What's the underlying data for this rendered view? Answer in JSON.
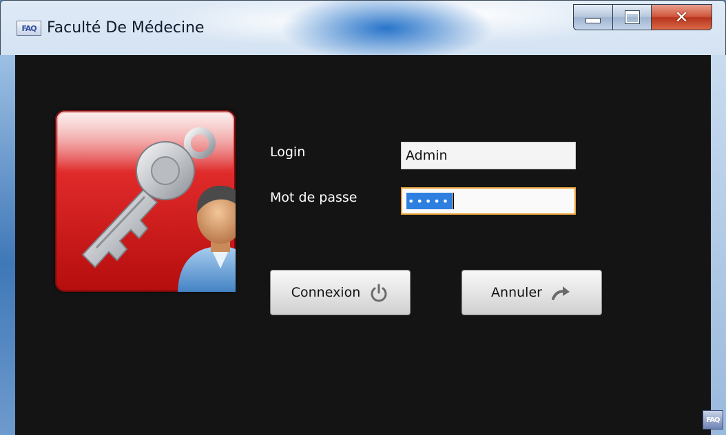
{
  "window": {
    "title": "Faculté De Médecine",
    "app_icon_text": "FAQ",
    "controls": {
      "minimize": "minimize",
      "maximize": "maximize",
      "close": "close"
    }
  },
  "form": {
    "login_label": "Login",
    "login_value": "Admin",
    "password_label": "Mot de passe",
    "password_masked": "•••••"
  },
  "buttons": {
    "connect_label": "Connexion",
    "connect_icon": "power-icon",
    "cancel_label": "Annuler",
    "cancel_icon": "undo-arrow-icon"
  },
  "footer": {
    "corner_icon_text": "FAQ"
  },
  "colors": {
    "client_bg": "#141414",
    "accent_focus": "#e8a33a",
    "selection": "#2f7fe0",
    "logo_red": "#d01818"
  }
}
